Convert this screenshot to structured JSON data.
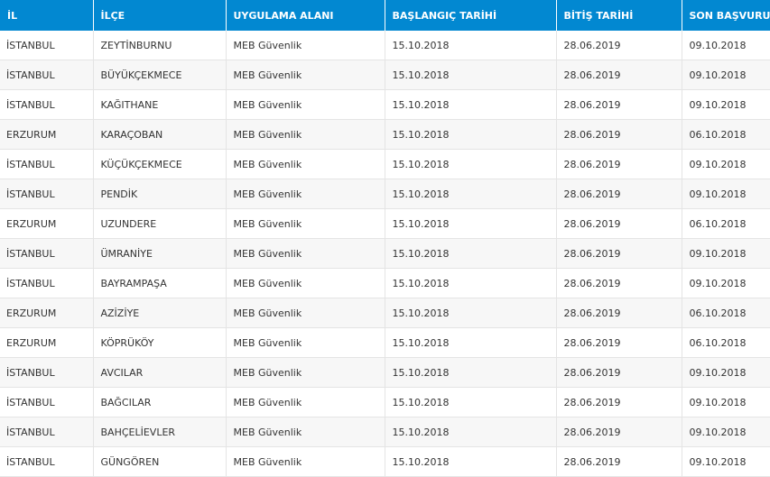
{
  "headers": [
    "İL",
    "İLÇE",
    "UYGULAMA ALANI",
    "BAŞLANGIÇ TARİHİ",
    "BİTİŞ TARİHİ",
    "SON BAŞVURU"
  ],
  "rows": [
    [
      "İSTANBUL",
      "ZEYTİNBURNU",
      "MEB Güvenlik",
      "15.10.2018",
      "28.06.2019",
      "09.10.2018"
    ],
    [
      "İSTANBUL",
      "BÜYÜKÇEKMECE",
      "MEB Güvenlik",
      "15.10.2018",
      "28.06.2019",
      "09.10.2018"
    ],
    [
      "İSTANBUL",
      "KAĞITHANE",
      "MEB Güvenlik",
      "15.10.2018",
      "28.06.2019",
      "09.10.2018"
    ],
    [
      "ERZURUM",
      "KARAÇOBAN",
      "MEB Güvenlik",
      "15.10.2018",
      "28.06.2019",
      "06.10.2018"
    ],
    [
      "İSTANBUL",
      "KÜÇÜKÇEKMECE",
      "MEB Güvenlik",
      "15.10.2018",
      "28.06.2019",
      "09.10.2018"
    ],
    [
      "İSTANBUL",
      "PENDİK",
      "MEB Güvenlik",
      "15.10.2018",
      "28.06.2019",
      "09.10.2018"
    ],
    [
      "ERZURUM",
      "UZUNDERE",
      "MEB Güvenlik",
      "15.10.2018",
      "28.06.2019",
      "06.10.2018"
    ],
    [
      "İSTANBUL",
      "ÜMRANİYE",
      "MEB Güvenlik",
      "15.10.2018",
      "28.06.2019",
      "09.10.2018"
    ],
    [
      "İSTANBUL",
      "BAYRAMPAŞA",
      "MEB Güvenlik",
      "15.10.2018",
      "28.06.2019",
      "09.10.2018"
    ],
    [
      "ERZURUM",
      "AZİZİYE",
      "MEB Güvenlik",
      "15.10.2018",
      "28.06.2019",
      "06.10.2018"
    ],
    [
      "ERZURUM",
      "KÖPRÜKÖY",
      "MEB Güvenlik",
      "15.10.2018",
      "28.06.2019",
      "06.10.2018"
    ],
    [
      "İSTANBUL",
      "AVCILAR",
      "MEB Güvenlik",
      "15.10.2018",
      "28.06.2019",
      "09.10.2018"
    ],
    [
      "İSTANBUL",
      "BAĞCILAR",
      "MEB Güvenlik",
      "15.10.2018",
      "28.06.2019",
      "09.10.2018"
    ],
    [
      "İSTANBUL",
      "BAHÇELİEVLER",
      "MEB Güvenlik",
      "15.10.2018",
      "28.06.2019",
      "09.10.2018"
    ],
    [
      "İSTANBUL",
      "GÜNGÖREN",
      "MEB Güvenlik",
      "15.10.2018",
      "28.06.2019",
      "09.10.2018"
    ]
  ],
  "colors": {
    "header_bg": "#0288d1",
    "header_text": "#ffffff",
    "row_alt_bg": "#f7f7f7",
    "border": "#e4e4e4"
  }
}
